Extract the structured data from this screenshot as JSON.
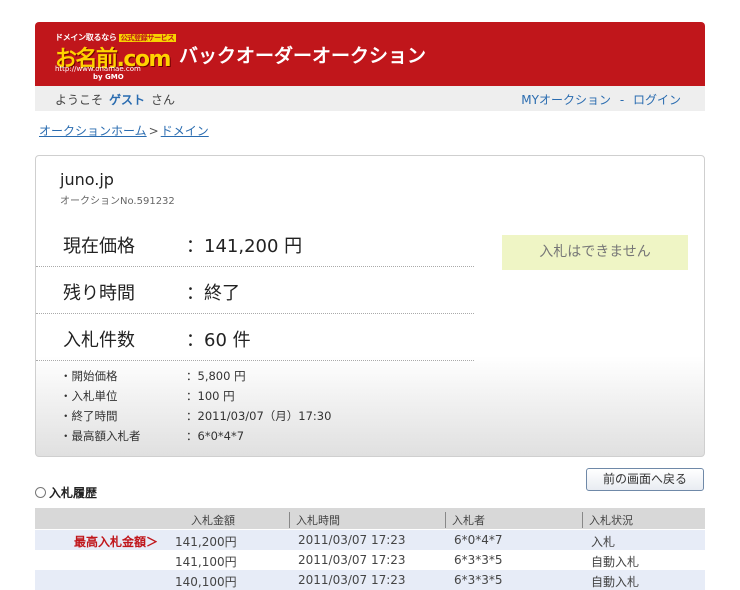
{
  "header": {
    "logo_line1": "ドメイン取るなら",
    "logo_badge": "公式登録サービス",
    "logo_main": "お名前.com",
    "logo_url": "http://www.onamae.com",
    "logo_by": "by GMO",
    "title": "バックオーダーオークション",
    "color": "#c0161b"
  },
  "welcome": {
    "prefix": "ようこそ",
    "user": "ゲスト",
    "suffix": "さん"
  },
  "top_links": {
    "my_auction": "MYオークション",
    "separator": "-",
    "login": "ログイン"
  },
  "breadcrumb": {
    "home": "オークションホーム",
    "sep": ">",
    "domain": "ドメイン"
  },
  "auction": {
    "domain": "juno.jp",
    "auction_no": "オークションNo.591232",
    "current_price_label": "現在価格",
    "current_price_value": "：141,200 円",
    "remaining_label": "残り時間",
    "remaining_value": "：終了",
    "bid_count_label": "入札件数",
    "bid_count_value": "：60 件",
    "bid_box": "入札はできません",
    "details": [
      {
        "label": "・開始価格",
        "value": "：5,800 円"
      },
      {
        "label": "・入札単位",
        "value": "：100 円"
      },
      {
        "label": "・終了時間",
        "value": "：2011/03/07（月）17:30"
      },
      {
        "label": "・最高額入札者",
        "value": "：6*0*4*7"
      }
    ]
  },
  "back_button": "前の画面へ戻る",
  "history": {
    "title": "入札履歴",
    "headers": [
      "入札金額",
      "入札時間",
      "入札者",
      "入札状況"
    ],
    "top_label": "最高入札金額＞",
    "rows": [
      {
        "amount": "141,200円",
        "time": "2011/03/07 17:23",
        "bidder": "6*0*4*7",
        "status": "入札"
      },
      {
        "amount": "141,100円",
        "time": "2011/03/07 17:23",
        "bidder": "6*3*3*5",
        "status": "自動入札"
      },
      {
        "amount": "140,100円",
        "time": "2011/03/07 17:23",
        "bidder": "6*3*3*5",
        "status": "自動入札"
      }
    ]
  }
}
